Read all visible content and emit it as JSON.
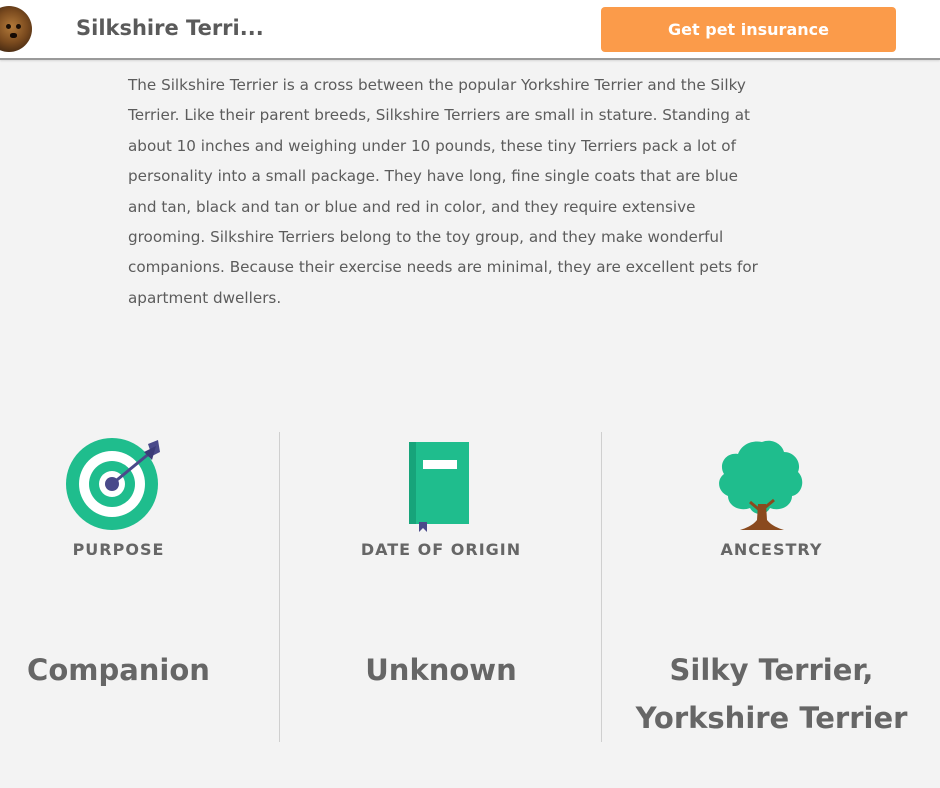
{
  "header": {
    "title": "Silkshire Terri...",
    "cta_label": "Get pet insurance",
    "accent_color": "#fb9b4a"
  },
  "description": "The Silkshire Terrier is a cross between the popular Yorkshire Terrier and the Silky Terrier. Like their parent breeds, Silkshire Terriers are small in stature. Standing at about 10 inches and weighing under 10 pounds, these tiny Terriers pack a lot of personality into a small package. They have long, fine single coats that are blue and tan, black and tan or blue and red in color, and they require extensive grooming. Silkshire Terriers belong to the toy group, and they make wonderful companions. Because their exercise needs are minimal, they are excellent pets for apartment dwellers.",
  "facts": [
    {
      "icon": "target-icon",
      "label": "PURPOSE",
      "value": "Companion"
    },
    {
      "icon": "book-icon",
      "label": "DATE OF ORIGIN",
      "value": "Unknown"
    },
    {
      "icon": "tree-icon",
      "label": "ANCESTRY",
      "value_line1": "Silky Terrier,",
      "value_line2": "Yorkshire Terrier"
    }
  ],
  "icon_color": "#1fbd8d"
}
